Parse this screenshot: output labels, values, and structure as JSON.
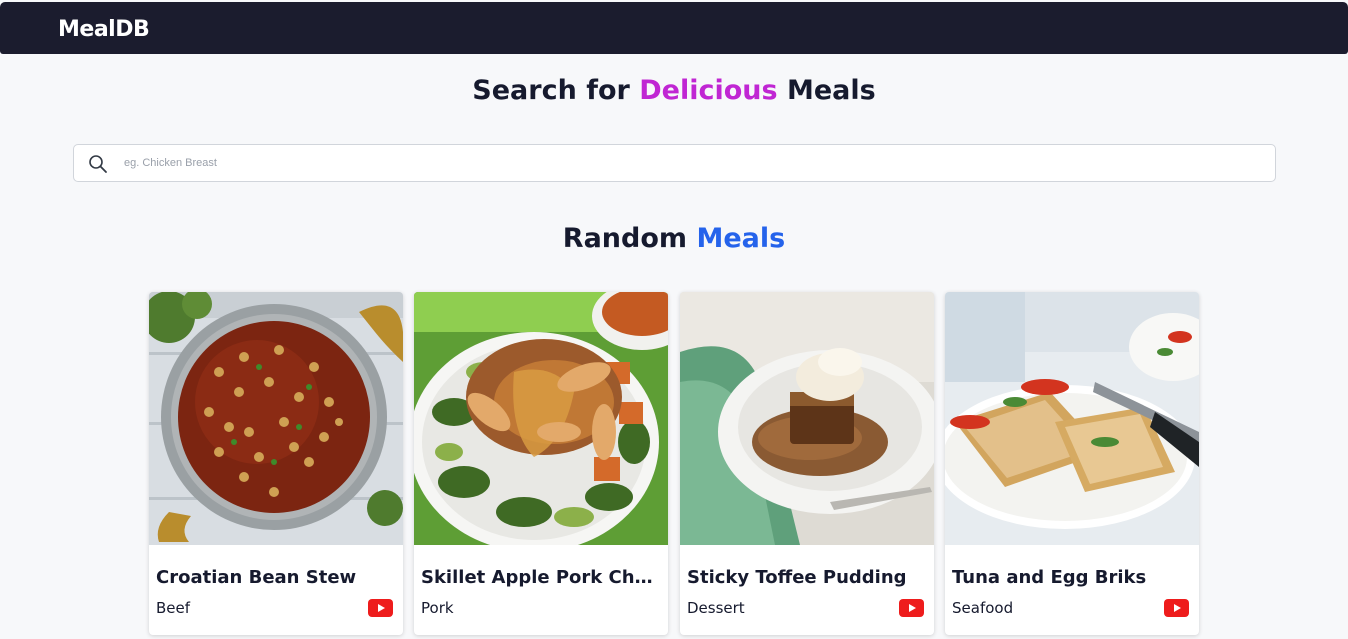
{
  "header": {
    "brand": "MealDB"
  },
  "hero": {
    "title_prefix": "Search for ",
    "title_accent": "Delicious",
    "title_suffix": " Meals",
    "accent_color": "#c026d3"
  },
  "search": {
    "placeholder": "eg. Chicken Breast",
    "value": "",
    "icon": "search-icon"
  },
  "random": {
    "title_prefix": "Random ",
    "title_accent": "Meals",
    "accent_color": "#2563eb"
  },
  "meals": [
    {
      "name": "Croatian Bean Stew",
      "category": "Beef",
      "youtube": true
    },
    {
      "name": "Skillet Apple Pork Chops with Roasted Sweet Potatoes & Zucchini",
      "category": "Pork",
      "youtube": false
    },
    {
      "name": "Sticky Toffee Pudding",
      "category": "Dessert",
      "youtube": true
    },
    {
      "name": "Tuna and Egg Briks",
      "category": "Seafood",
      "youtube": true
    }
  ],
  "colors": {
    "navbar": "#1b1c2e",
    "background": "#f7f8fa",
    "youtube": "#ee1c1c"
  }
}
